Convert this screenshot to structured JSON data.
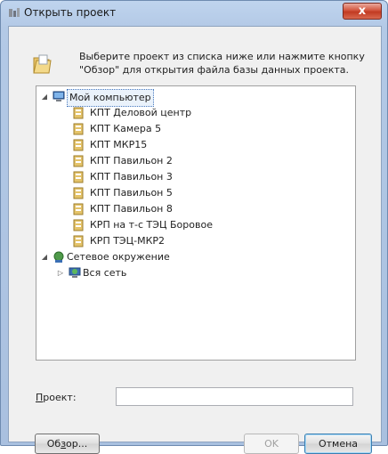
{
  "window": {
    "title": "Открыть проект",
    "close_label": "x"
  },
  "instruction": {
    "line1": "Выберите проект из списка ниже или нажмите кнопку",
    "line2": "\"Обзор\" для открытия файла базы данных проекта."
  },
  "tree": {
    "my_computer": {
      "label": "Мой компьютер",
      "expanded": true,
      "children": [
        "КПТ Деловой центр",
        "КПТ Камера 5",
        "КПТ МКР15",
        "КПТ Павильон 2",
        "КПТ Павильон 3",
        "КПТ Павильон 5",
        "КПТ Павильон 8",
        "КРП на т-с ТЭЦ Боровое",
        "КРП ТЭЦ-МКР2"
      ]
    },
    "network": {
      "label": "Сетевое окружение",
      "expanded": true,
      "children": [
        "Вся сеть"
      ]
    }
  },
  "project_field": {
    "label_accel": "П",
    "label_rest": "роект:",
    "value": ""
  },
  "buttons": {
    "browse_accel_before": "Об",
    "browse_accel": "з",
    "browse_after": "ор...",
    "ok": "OK",
    "cancel": "Отмена"
  },
  "colors": {
    "frame": "#b3c9e6",
    "close": "#c23a22",
    "selection_border": "#4a7bbf"
  }
}
